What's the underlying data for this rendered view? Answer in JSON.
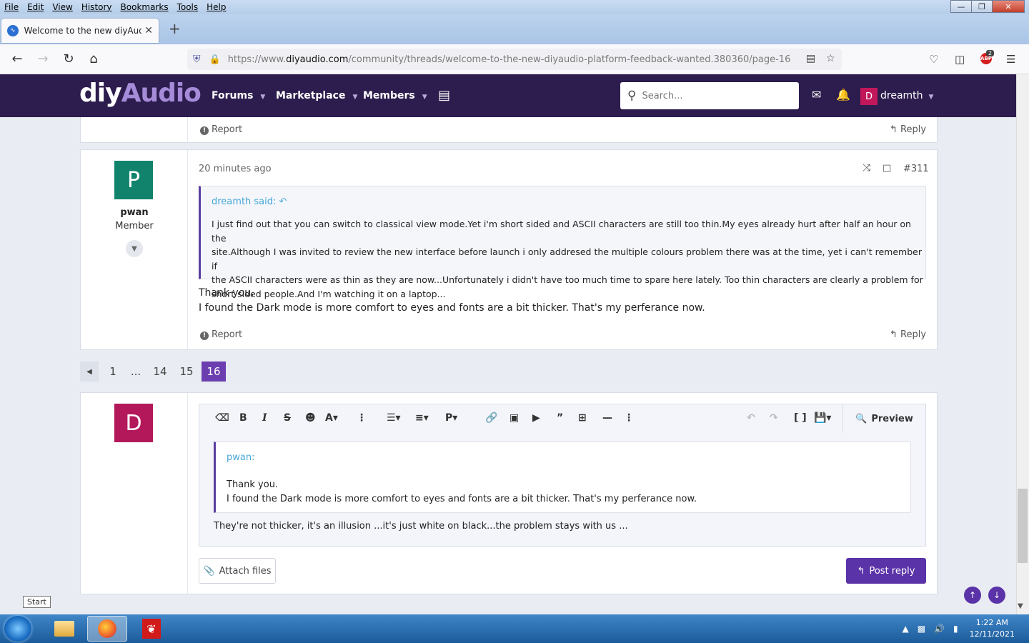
{
  "menubar": {
    "items": [
      "File",
      "Edit",
      "View",
      "History",
      "Bookmarks",
      "Tools",
      "Help"
    ]
  },
  "browser": {
    "tab_title": "Welcome to the new diyAudio p",
    "url_prefix": "https://www.",
    "url_domain": "diyaudio.com",
    "url_path": "/community/threads/welcome-to-the-new-diyaudio-platform-feedback-wanted.380360/page-16",
    "addon_badge_count": "2"
  },
  "site": {
    "logo_diy": "diy",
    "logo_audio": "Audio",
    "nav": [
      "Forums",
      "Marketplace",
      "Members"
    ],
    "search_placeholder": "Search...",
    "username": "dreamth",
    "avatar_letter": "D"
  },
  "prev_post": {
    "report_label": "Report",
    "reply_label": "Reply"
  },
  "post": {
    "avatar_letter": "P",
    "username": "pwan",
    "user_title": "Member",
    "time": "20 minutes ago",
    "number": "#311",
    "quote_author": "dreamth said:",
    "quote_lines": [
      "I just find out that you can switch to classical view mode.Yet i'm short sided and ASCII characters are still too thin.My eyes already hurt after half an hour on the",
      "site.Although I was invited to review the new interface before launch i only addresed the multiple colours problem there was at the time, yet i can't remember if",
      "the ASCII characters were as thin as they are now...Unfortunately i didn't have too much time to spare here lately. Too thin characters are clearly a problem for",
      "short sided people.And I'm watching it on a laptop..."
    ],
    "body_lines": [
      "Thank you.",
      "I found the Dark mode is more comfort to eyes and fonts are a bit thicker. That's my perferance now."
    ],
    "report_label": "Report",
    "reply_label": "Reply"
  },
  "pagination": {
    "pages": [
      "1",
      "...",
      "14",
      "15",
      "16"
    ],
    "current": "16"
  },
  "editor": {
    "avatar_letter": "D",
    "preview_label": "Preview",
    "quote_author": "pwan:",
    "quote_lines": [
      "Thank you.",
      "I found the Dark mode is more comfort to eyes and fonts are a bit thicker. That's my perferance now."
    ],
    "reply_text": "They're not thicker, it's an illusion ...it's just white on black...the problem stays with us ...",
    "attach_label": "Attach files",
    "post_reply_label": "Post reply"
  },
  "taskbar": {
    "start_tooltip": "Start",
    "time": "1:22 AM",
    "date": "12/11/2021"
  },
  "colors": {
    "header_bg": "#2d1d4e",
    "accent": "#5b33a8",
    "quote_link": "#47a7d8",
    "pwan_avatar": "#11836d",
    "dreamth_avatar": "#b3195a"
  }
}
